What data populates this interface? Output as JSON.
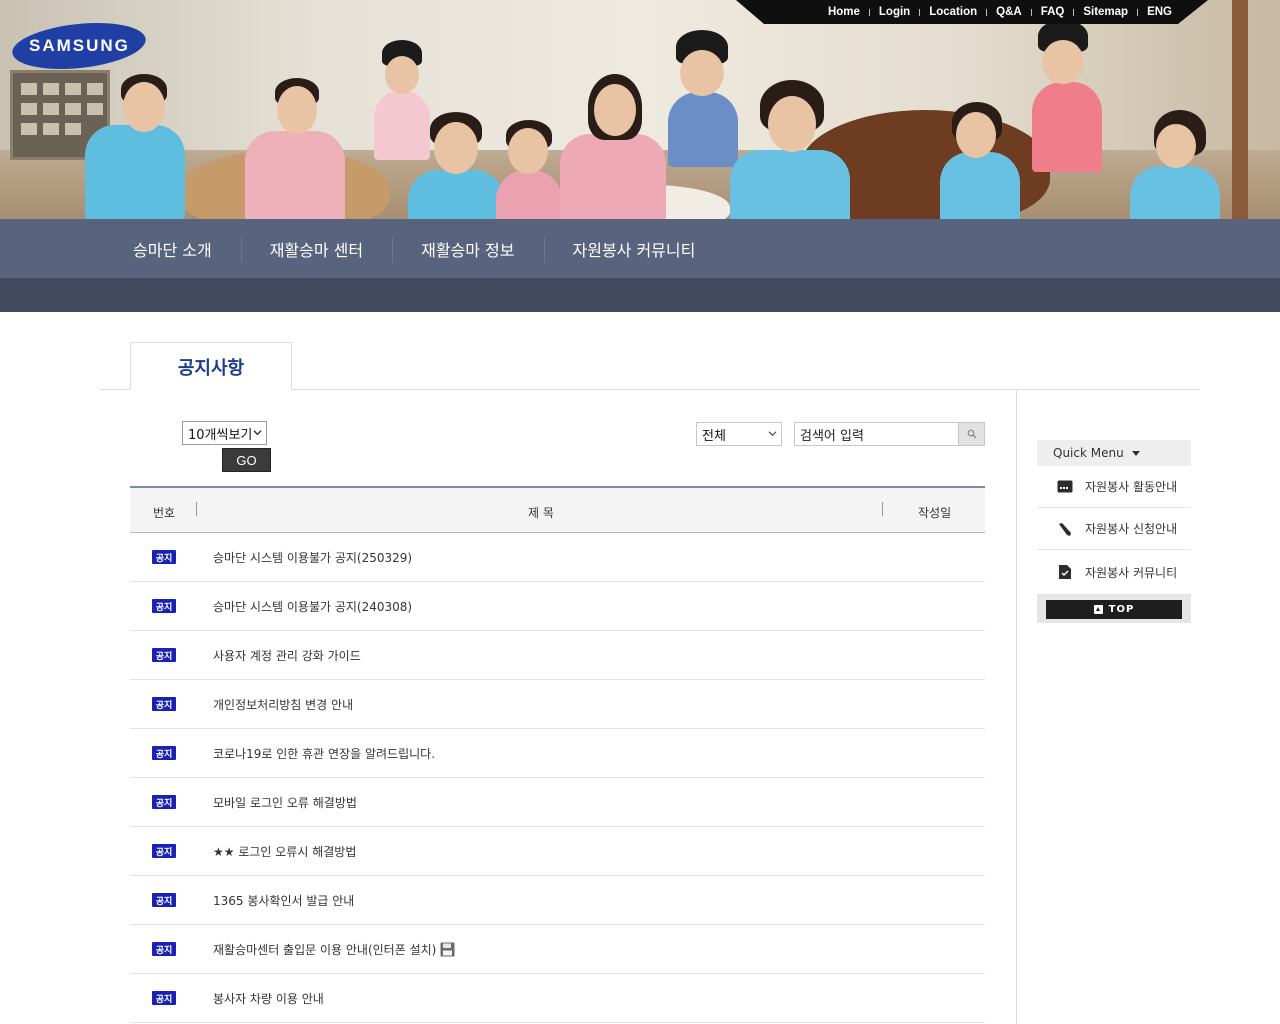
{
  "brand": {
    "logo_text": "SAMSUNG"
  },
  "utility_nav": [
    "Home",
    "Login",
    "Location",
    "Q&A",
    "FAQ",
    "Sitemap",
    "ENG"
  ],
  "main_nav": [
    "승마단 소개",
    "재활승마 센터",
    "재활승마 정보",
    "자원봉사 커뮤니티"
  ],
  "board": {
    "tab_title": "공지사항",
    "page_size_select": "10개씩보기",
    "go_label": "GO",
    "search_scope": "전체",
    "search_placeholder": "검색어 입력",
    "columns": {
      "number": "번호",
      "title": "제 목",
      "date": "작성일"
    },
    "notice_badge": "공지",
    "rows": [
      {
        "title": "승마단 시스템 이용불가 공지(250329)",
        "attachment": false
      },
      {
        "title": "승마단 시스템 이용불가 공지(240308)",
        "attachment": false
      },
      {
        "title": "사용자 계정 관리 강화 가이드",
        "attachment": false
      },
      {
        "title": "개인정보처리방침 변경 안내",
        "attachment": false
      },
      {
        "title": "코로나19로 인한 휴관 연장을 알려드립니다.",
        "attachment": false
      },
      {
        "title": "모바일 로그인 오류 해결방법",
        "attachment": false
      },
      {
        "title": "★★ 로그인 오류시 해결방법",
        "attachment": false
      },
      {
        "title": "1365 봉사확인서 발급 안내",
        "attachment": false
      },
      {
        "title": "재활승마센터 출입문 이용 안내(인터폰 설치)",
        "attachment": true
      },
      {
        "title": "봉사자 차량 이용 안내",
        "attachment": false
      }
    ]
  },
  "quick_menu": {
    "title": "Quick Menu",
    "items": [
      {
        "label": "자원봉사 활동안내",
        "icon": "calendar-icon"
      },
      {
        "label": "자원봉사 신청안내",
        "icon": "pen-icon"
      },
      {
        "label": "자원봉사 커뮤니티",
        "icon": "document-check-icon"
      }
    ],
    "top_label": "TOP"
  },
  "colors": {
    "nav": "#58637e",
    "subnav": "#414a5e",
    "badge": "#1a22b3",
    "tab_title": "#1d3b8f"
  }
}
